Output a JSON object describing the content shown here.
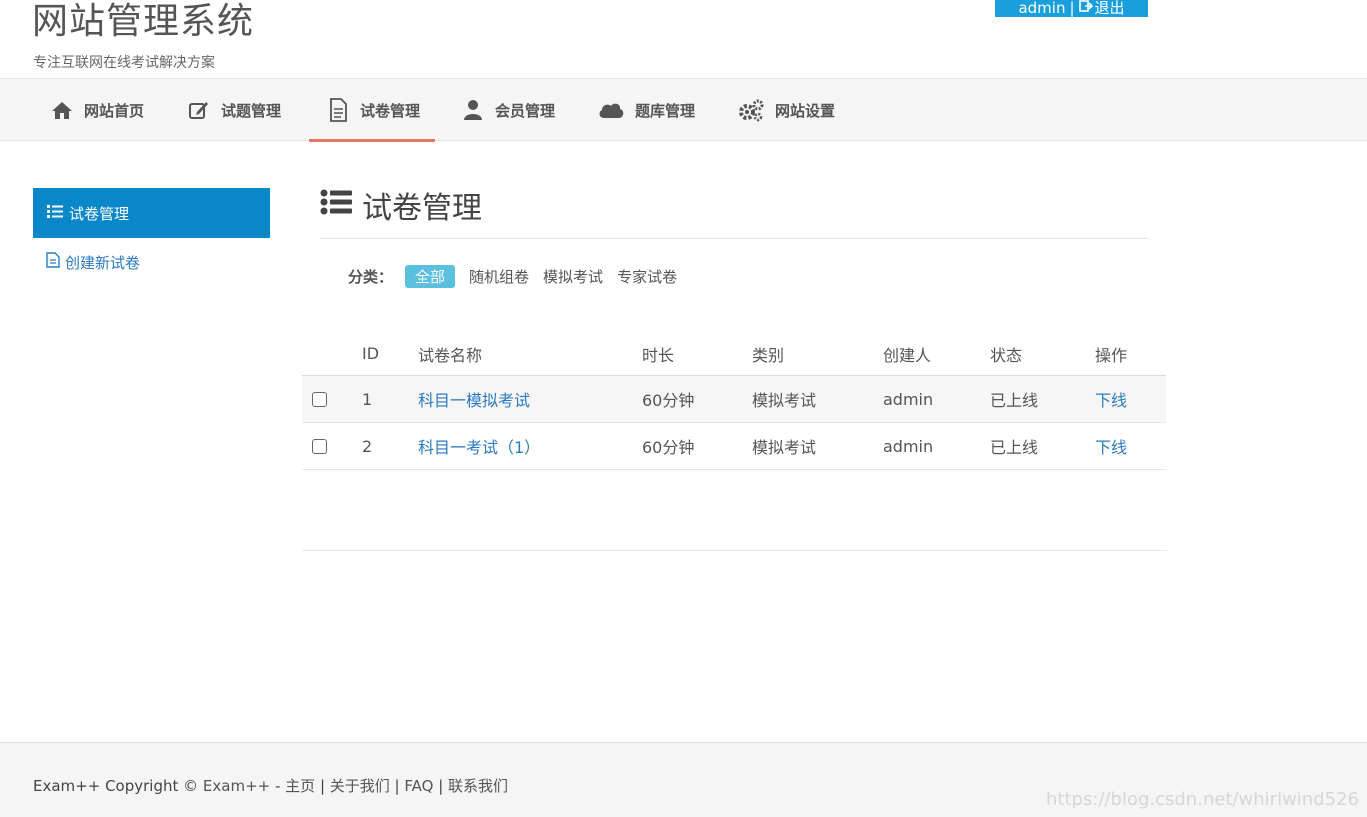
{
  "header": {
    "title": "网站管理系统",
    "subtitle": "专注互联网在线考试解决方案",
    "user": "admin",
    "separator": "|",
    "logout_label": "退出"
  },
  "nav": {
    "items": [
      {
        "label": "网站首页",
        "icon": "home-icon"
      },
      {
        "label": "试题管理",
        "icon": "edit-icon"
      },
      {
        "label": "试卷管理",
        "icon": "document-icon",
        "active": true
      },
      {
        "label": "会员管理",
        "icon": "user-icon"
      },
      {
        "label": "题库管理",
        "icon": "cloud-icon"
      },
      {
        "label": "网站设置",
        "icon": "gears-icon"
      }
    ],
    "active_color": "#e8776a"
  },
  "sidebar": {
    "active_label": "试卷管理",
    "link_label": "创建新试卷",
    "active_color": "#0a87c8"
  },
  "main": {
    "title": "试卷管理",
    "filter": {
      "label": "分类：",
      "options": [
        "全部",
        "随机组卷",
        "模拟考试",
        "专家试卷"
      ],
      "selected": "全部"
    },
    "table": {
      "headers": [
        "ID",
        "试卷名称",
        "时长",
        "类别",
        "创建人",
        "状态",
        "操作"
      ],
      "rows": [
        {
          "id": "1",
          "name": "科目一模拟考试",
          "duration": "60分钟",
          "category": "模拟考试",
          "creator": "admin",
          "status": "已上线",
          "action": "下线"
        },
        {
          "id": "2",
          "name": "科目一考试（1）",
          "duration": "60分钟",
          "category": "模拟考试",
          "creator": "admin",
          "status": "已上线",
          "action": "下线"
        }
      ]
    }
  },
  "footer": {
    "copyright": "Exam++ Copyright © ",
    "brand_link": "Exam++",
    "dash": " - ",
    "links": [
      "主页",
      "关于我们",
      "FAQ",
      "联系我们"
    ],
    "divider": " | ",
    "watermark": "https://blog.csdn.net/whirlwind526"
  },
  "colors": {
    "primary": "#1a9fdc",
    "link": "#2a7ac0",
    "filter_active": "#5bc0de"
  }
}
